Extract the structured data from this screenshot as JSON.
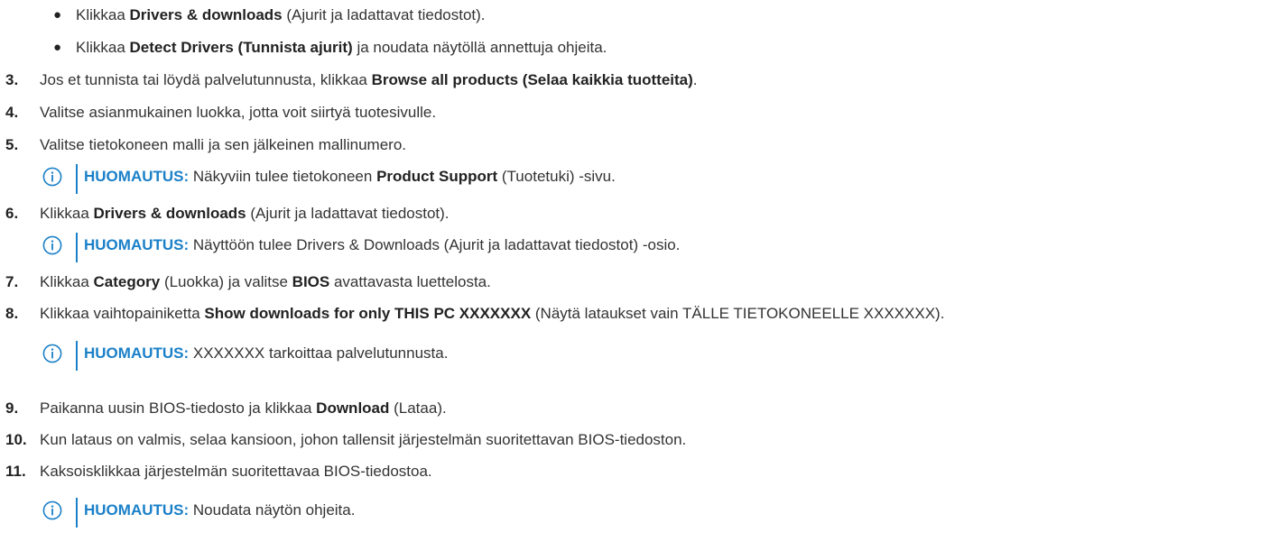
{
  "bullets": [
    {
      "prefix": "Klikkaa ",
      "bold": "Drivers & downloads",
      "suffix": " (Ajurit ja ladattavat tiedostot)."
    },
    {
      "prefix": "Klikkaa ",
      "bold": "Detect Drivers (Tunnista ajurit)",
      "suffix": " ja noudata näytöllä annettuja ohjeita."
    }
  ],
  "bullet_symbol": "●",
  "note_label": "HUOMAUTUS:",
  "steps": {
    "s3": {
      "num": "3.",
      "prefix": "Jos et tunnista tai löydä palvelutunnusta, klikkaa ",
      "bold": "Browse all products (Selaa kaikkia tuotteita)",
      "suffix": "."
    },
    "s4": {
      "num": "4.",
      "text": "Valitse asianmukainen luokka, jotta voit siirtyä tuotesivulle."
    },
    "s5": {
      "num": "5.",
      "text": "Valitse tietokoneen malli ja sen jälkeinen mallinumero.",
      "note": {
        "prefix": " Näkyviin tulee tietokoneen ",
        "bold": "Product Support",
        "suffix": " (Tuotetuki) -sivu."
      }
    },
    "s6": {
      "num": "6.",
      "prefix": "Klikkaa ",
      "bold": "Drivers & downloads",
      "suffix": " (Ajurit ja ladattavat tiedostot).",
      "note": {
        "text": " Näyttöön tulee Drivers & Downloads (Ajurit ja ladattavat tiedostot) -osio."
      }
    },
    "s7": {
      "num": "7.",
      "prefix": "Klikkaa ",
      "bold1": "Category",
      "middle": " (Luokka) ja valitse ",
      "bold2": "BIOS",
      "suffix": " avattavasta luettelosta."
    },
    "s8": {
      "num": "8.",
      "prefix": "Klikkaa vaihtopainiketta ",
      "bold": "Show downloads for only THIS PC XXXXXXX",
      "suffix": " (Näytä lataukset vain TÄLLE TIETOKONEELLE XXXXXXX).",
      "note": {
        "text": " XXXXXXX tarkoittaa palvelutunnusta."
      }
    },
    "s9": {
      "num": "9.",
      "prefix": "Paikanna uusin BIOS-tiedosto ja klikkaa ",
      "bold": "Download",
      "suffix": " (Lataa)."
    },
    "s10": {
      "num": "10.",
      "text": "Kun lataus on valmis, selaa kansioon, johon tallensit järjestelmän suoritettavan BIOS-tiedoston."
    },
    "s11": {
      "num": "11.",
      "text": "Kaksoisklikkaa järjestelmän suoritettavaa BIOS-tiedostoa.",
      "note": {
        "text": " Noudata näytön ohjeita."
      }
    }
  }
}
